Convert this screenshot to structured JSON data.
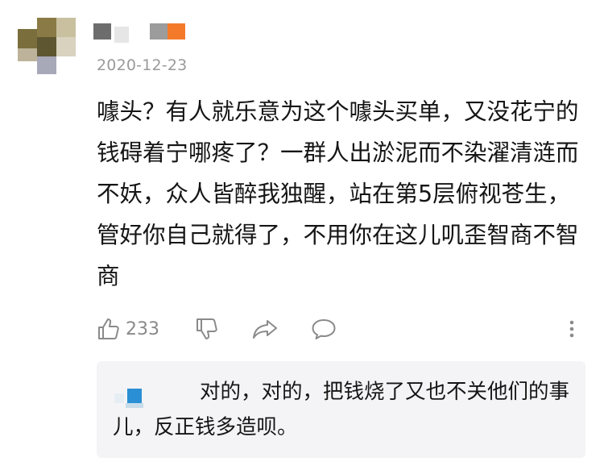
{
  "comment": {
    "date": "2020-12-23",
    "text": "噱头？有人就乐意为这个噱头买单，又没花宁的钱碍着宁哪疼了？一群人出淤泥而不染濯清涟而不妖，众人皆醉我独醒，站在第5层俯视苍生，管好你自己就得了，不用你在这儿叽歪智商不智商"
  },
  "actions": {
    "like_count": "233",
    "icons": {
      "like": "thumbs-up-icon",
      "dislike": "thumbs-down-icon",
      "share": "share-arrow-icon",
      "reply": "comment-bubble-icon",
      "more": "more-vertical-icon"
    }
  },
  "reply": {
    "text": "对的，对的，把钱烧了又也不关他们的事儿，反正钱多造呗。"
  },
  "colors": {
    "reply_background": "#f4f4f6",
    "date": "#9a9a9a",
    "icon": "#8a8a8a",
    "username_accent": "#f47a2a",
    "reply_avatar_accent": "#2a8fd4"
  }
}
